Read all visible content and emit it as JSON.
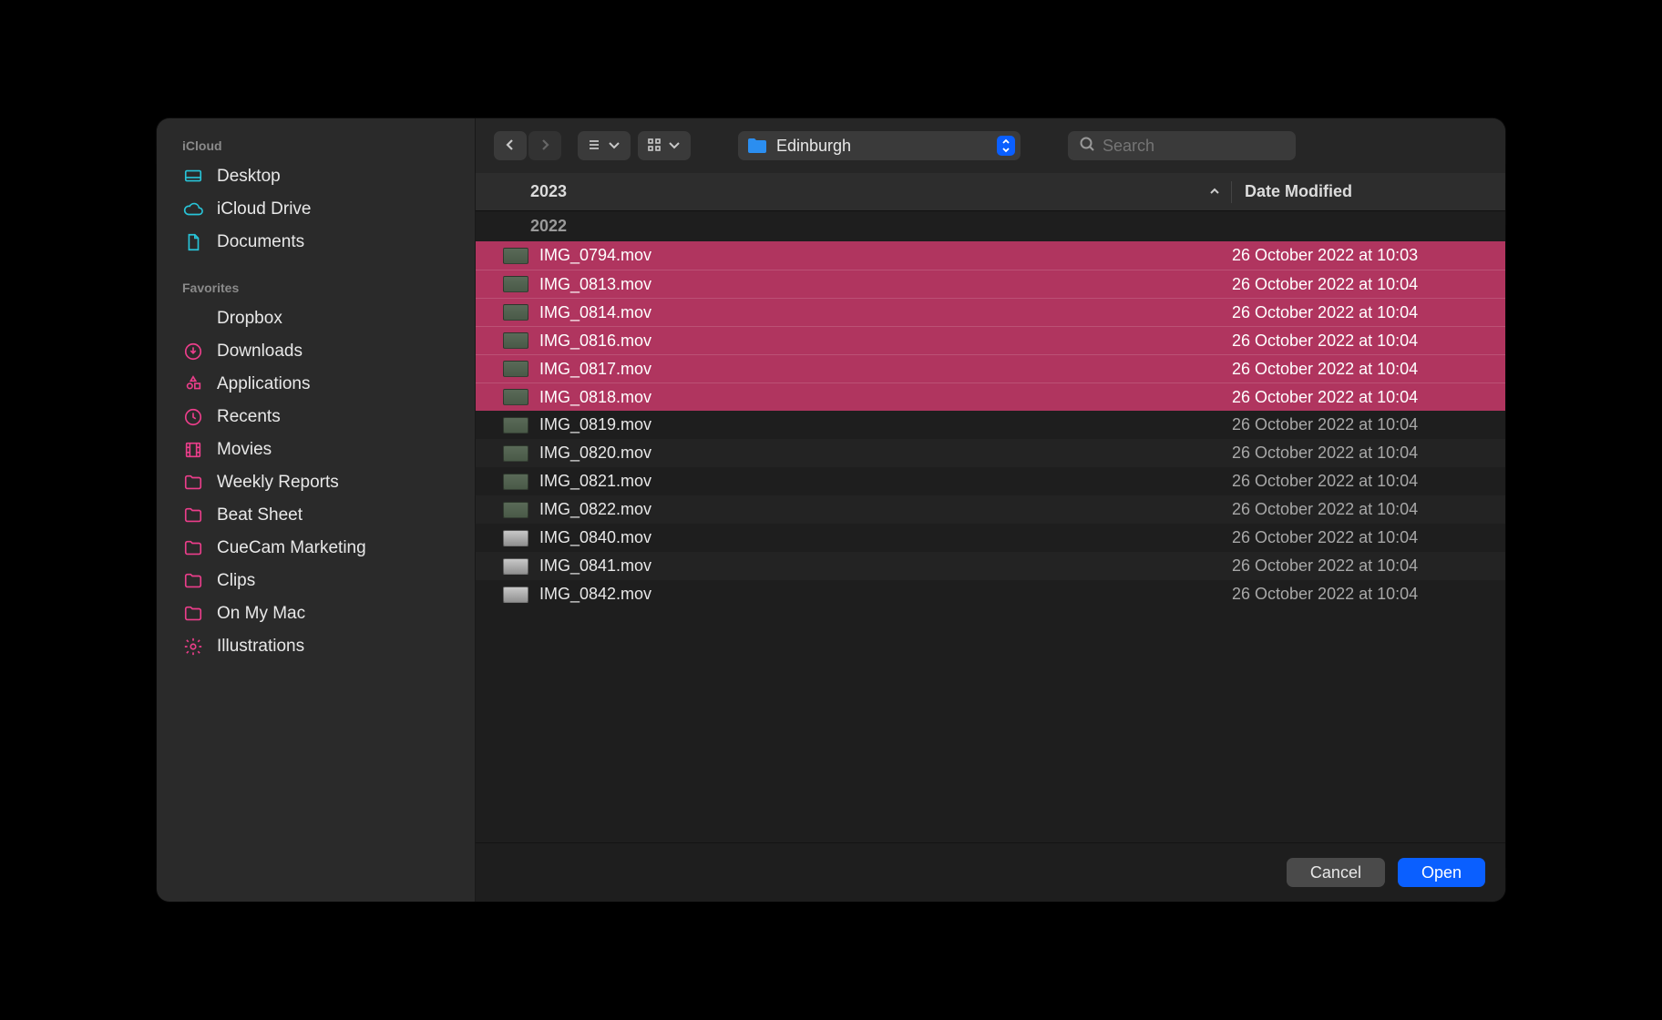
{
  "sidebar": {
    "groups": [
      {
        "heading": "iCloud",
        "items": [
          {
            "label": "Desktop",
            "icon": "desktop",
            "tint": "cyan"
          },
          {
            "label": "iCloud Drive",
            "icon": "cloud",
            "tint": "cyan"
          },
          {
            "label": "Documents",
            "icon": "document",
            "tint": "cyan"
          }
        ]
      },
      {
        "heading": "Favorites",
        "items": [
          {
            "label": "Dropbox",
            "icon": "dropbox",
            "tint": "pink"
          },
          {
            "label": "Downloads",
            "icon": "download",
            "tint": "pink"
          },
          {
            "label": "Applications",
            "icon": "apps",
            "tint": "pink"
          },
          {
            "label": "Recents",
            "icon": "clock",
            "tint": "pink"
          },
          {
            "label": "Movies",
            "icon": "film",
            "tint": "pink"
          },
          {
            "label": "Weekly Reports",
            "icon": "folder",
            "tint": "pink"
          },
          {
            "label": "Beat Sheet",
            "icon": "folder",
            "tint": "pink"
          },
          {
            "label": "CueCam Marketing",
            "icon": "folder",
            "tint": "pink"
          },
          {
            "label": "Clips",
            "icon": "folder",
            "tint": "pink"
          },
          {
            "label": "On My Mac",
            "icon": "folder",
            "tint": "pink"
          },
          {
            "label": "Illustrations",
            "icon": "gear",
            "tint": "pink"
          }
        ]
      }
    ]
  },
  "toolbar": {
    "folder_name": "Edinburgh",
    "search_placeholder": "Search"
  },
  "columns": {
    "name_label": "2023",
    "date_label": "Date Modified"
  },
  "group_header": "2022",
  "files": [
    {
      "name": "IMG_0794.mov",
      "date": "26 October 2022 at 10:03",
      "selected": true,
      "light": false
    },
    {
      "name": "IMG_0813.mov",
      "date": "26 October 2022 at 10:04",
      "selected": true,
      "light": false
    },
    {
      "name": "IMG_0814.mov",
      "date": "26 October 2022 at 10:04",
      "selected": true,
      "light": false
    },
    {
      "name": "IMG_0816.mov",
      "date": "26 October 2022 at 10:04",
      "selected": true,
      "light": false
    },
    {
      "name": "IMG_0817.mov",
      "date": "26 October 2022 at 10:04",
      "selected": true,
      "light": false
    },
    {
      "name": "IMG_0818.mov",
      "date": "26 October 2022 at 10:04",
      "selected": true,
      "light": false
    },
    {
      "name": "IMG_0819.mov",
      "date": "26 October 2022 at 10:04",
      "selected": false,
      "light": false
    },
    {
      "name": "IMG_0820.mov",
      "date": "26 October 2022 at 10:04",
      "selected": false,
      "light": false
    },
    {
      "name": "IMG_0821.mov",
      "date": "26 October 2022 at 10:04",
      "selected": false,
      "light": false
    },
    {
      "name": "IMG_0822.mov",
      "date": "26 October 2022 at 10:04",
      "selected": false,
      "light": false
    },
    {
      "name": "IMG_0840.mov",
      "date": "26 October 2022 at 10:04",
      "selected": false,
      "light": true
    },
    {
      "name": "IMG_0841.mov",
      "date": "26 October 2022 at 10:04",
      "selected": false,
      "light": true
    },
    {
      "name": "IMG_0842.mov",
      "date": "26 October 2022 at 10:04",
      "selected": false,
      "light": true
    }
  ],
  "footer": {
    "cancel_label": "Cancel",
    "open_label": "Open"
  }
}
